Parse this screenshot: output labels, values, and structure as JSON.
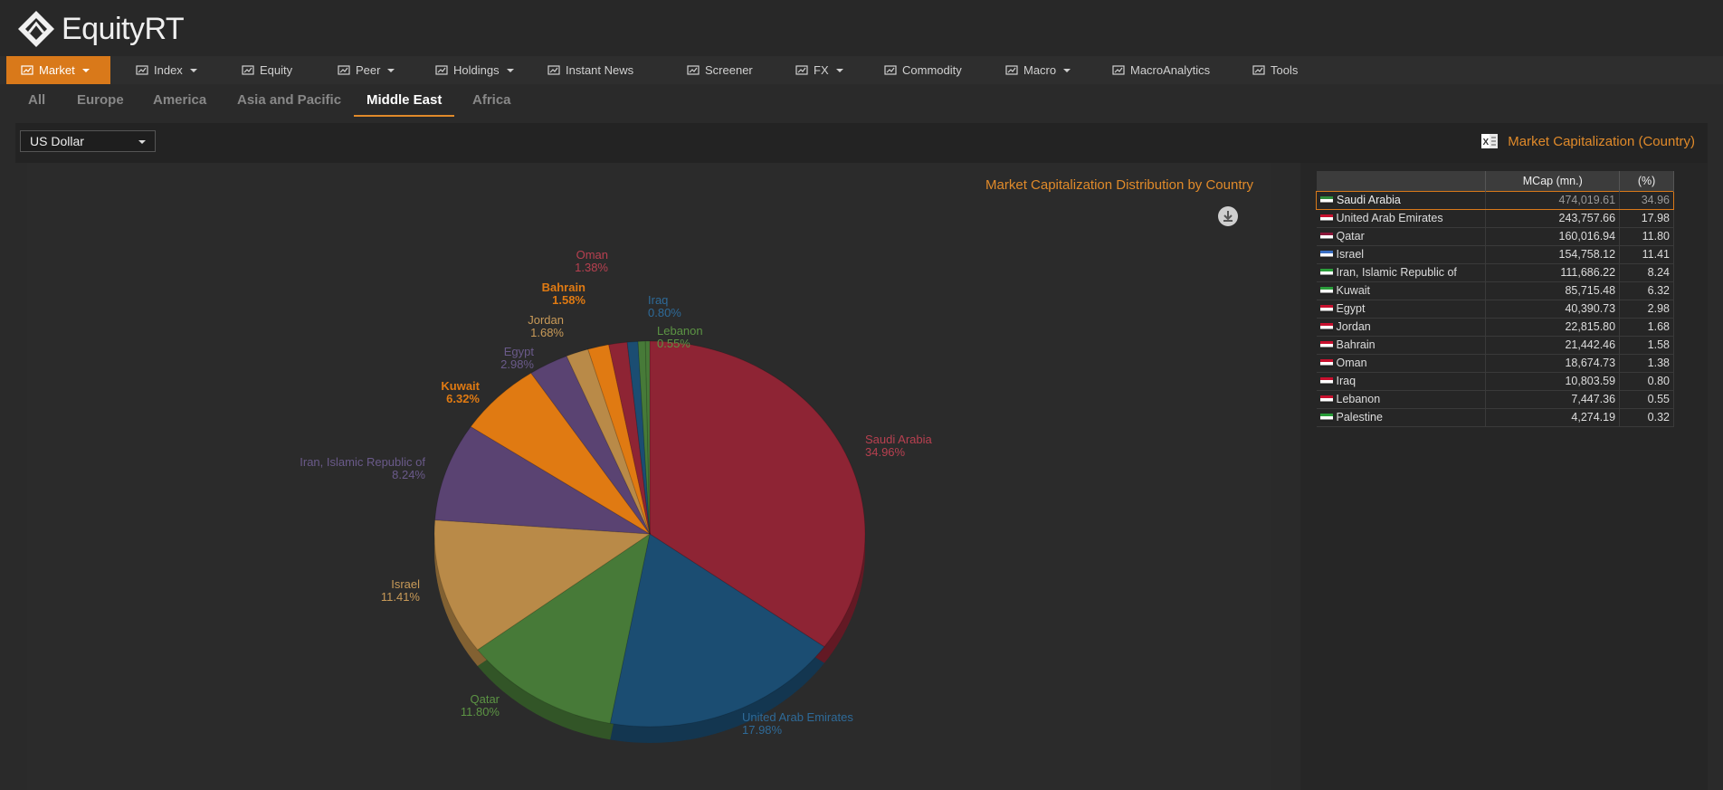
{
  "app": {
    "name": "EquityRT"
  },
  "menu": [
    {
      "label": "Market",
      "icon": "chart-icon",
      "dropdown": true,
      "active": true
    },
    {
      "label": "Index",
      "icon": "monitor-chart-icon",
      "dropdown": true
    },
    {
      "label": "Equity",
      "icon": "bar-chart-icon",
      "dropdown": false
    },
    {
      "label": "Peer",
      "icon": "line-chart-icon",
      "dropdown": true
    },
    {
      "label": "Holdings",
      "icon": "holdings-icon",
      "dropdown": true
    },
    {
      "label": "Instant News",
      "icon": "broadcast-icon",
      "dropdown": false
    },
    {
      "label": "Screener",
      "icon": "screener-icon",
      "dropdown": false
    },
    {
      "label": "FX",
      "icon": "fx-icon",
      "dropdown": true
    },
    {
      "label": "Commodity",
      "icon": "document-icon",
      "dropdown": false
    },
    {
      "label": "Macro",
      "icon": "globe-icon",
      "dropdown": true
    },
    {
      "label": "MacroAnalytics",
      "icon": "monitor-icon",
      "dropdown": false
    },
    {
      "label": "Tools",
      "icon": "gears-icon",
      "dropdown": false
    }
  ],
  "region_tabs": [
    "All",
    "Europe",
    "America",
    "Asia and Pacific",
    "Middle East",
    "Africa"
  ],
  "active_region": "Middle East",
  "currency": {
    "selected": "US Dollar"
  },
  "export": {
    "label": "Market Capitalization (Country)",
    "icon": "excel-icon"
  },
  "chart_data": {
    "type": "pie",
    "title": "Market Capitalization Distribution by Country",
    "categories": [
      "Saudi Arabia",
      "United Arab Emirates",
      "Qatar",
      "Israel",
      "Iran, Islamic Republic of",
      "Kuwait",
      "Egypt",
      "Jordan",
      "Bahrain",
      "Oman",
      "Iraq",
      "Lebanon",
      "Palestine"
    ],
    "values": [
      34.96,
      17.98,
      11.8,
      11.41,
      8.24,
      6.32,
      2.98,
      1.68,
      1.58,
      1.38,
      0.8,
      0.55,
      0.32
    ],
    "percent_labels": [
      "34.96%",
      "17.98%",
      "11.80%",
      "11.41%",
      "8.24%",
      "6.32%",
      "2.98%",
      "1.68%",
      "1.58%",
      "1.38%",
      "0.80%",
      "0.55%",
      ""
    ],
    "colors": [
      "#8e2434",
      "#1b4d72",
      "#477a38",
      "#b98a48",
      "#5a4372",
      "#e07a12",
      "#5a4372",
      "#b98a48",
      "#e07a12",
      "#8e2434",
      "#1b4d72",
      "#477a38",
      "#477a38"
    ],
    "label_colors": [
      "#b84050",
      "#2e6a98",
      "#5c9444",
      "#c89a58",
      "#6a5a8a",
      "#e07a12",
      "#6a5a8a",
      "#c89a58",
      "#e07a12",
      "#b84050",
      "#2e6a98",
      "#5c9444",
      "#5c9444"
    ]
  },
  "table": {
    "columns": [
      "",
      "MCap (mn.)",
      "(%)"
    ],
    "rows": [
      {
        "country": "Saudi Arabia",
        "mcap": "474,019.61",
        "pct": "34.96",
        "flag": "#2e8b3a",
        "selected": true
      },
      {
        "country": "United Arab Emirates",
        "mcap": "243,757.66",
        "pct": "17.98",
        "flag": "#c8102e"
      },
      {
        "country": "Qatar",
        "mcap": "160,016.94",
        "pct": "11.80",
        "flag": "#8a1538"
      },
      {
        "country": "Israel",
        "mcap": "154,758.12",
        "pct": "11.41",
        "flag": "#3a6fc4"
      },
      {
        "country": "Iran, Islamic Republic of",
        "mcap": "111,686.22",
        "pct": "8.24",
        "flag": "#2a9d3a"
      },
      {
        "country": "Kuwait",
        "mcap": "85,715.48",
        "pct": "6.32",
        "flag": "#2a9d3a"
      },
      {
        "country": "Egypt",
        "mcap": "40,390.73",
        "pct": "2.98",
        "flag": "#c8102e"
      },
      {
        "country": "Jordan",
        "mcap": "22,815.80",
        "pct": "1.68",
        "flag": "#c8102e"
      },
      {
        "country": "Bahrain",
        "mcap": "21,442.46",
        "pct": "1.58",
        "flag": "#c8102e"
      },
      {
        "country": "Oman",
        "mcap": "18,674.73",
        "pct": "1.38",
        "flag": "#c8102e"
      },
      {
        "country": "Iraq",
        "mcap": "10,803.59",
        "pct": "0.80",
        "flag": "#c8102e"
      },
      {
        "country": "Lebanon",
        "mcap": "7,447.36",
        "pct": "0.55",
        "flag": "#c8102e"
      },
      {
        "country": "Palestine",
        "mcap": "4,274.19",
        "pct": "0.32",
        "flag": "#2a9d3a"
      }
    ]
  }
}
